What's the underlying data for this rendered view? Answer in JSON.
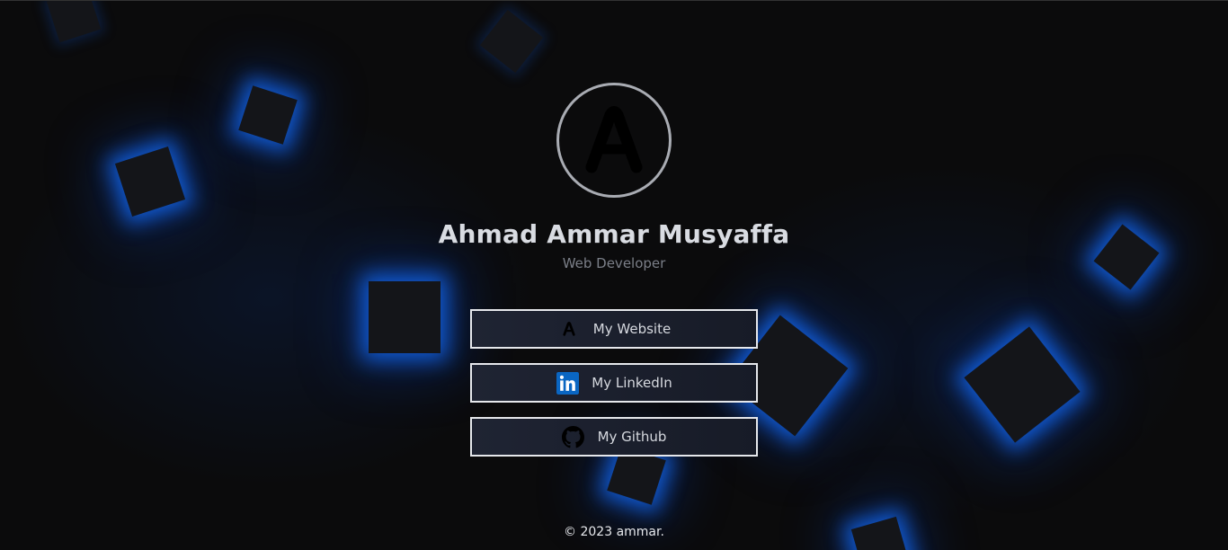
{
  "profile": {
    "avatar_letter": "A",
    "name": "Ahmad Ammar Musyaffa",
    "role": "Web Developer"
  },
  "links": [
    {
      "label": "My Website",
      "icon": "logo-a-icon"
    },
    {
      "label": "My LinkedIn",
      "icon": "linkedin-icon"
    },
    {
      "label": "My Github",
      "icon": "github-icon"
    }
  ],
  "footer": {
    "text": "© 2023 ammar."
  },
  "colors": {
    "background": "#0b0b0c",
    "glow": "#1470ff",
    "linkedin": "#0a66c2"
  }
}
